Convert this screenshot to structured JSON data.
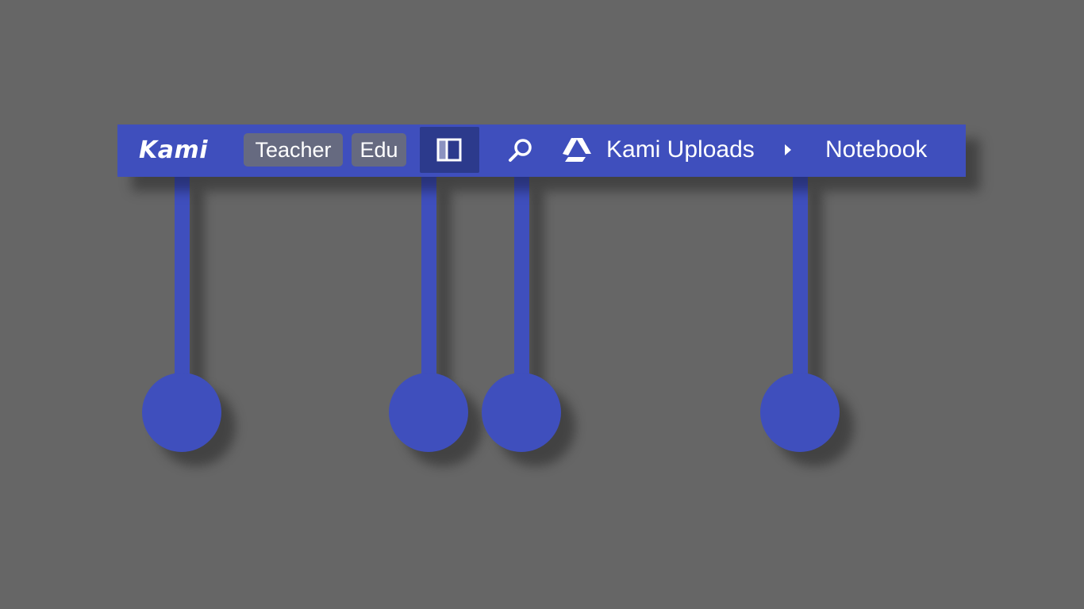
{
  "toolbar": {
    "logo": "Kami",
    "badges": [
      "Teacher",
      "Edu"
    ],
    "sidebar_toggle_icon": "sidebar-panel-icon",
    "search_icon": "search-icon",
    "drive_icon": "google-drive-icon",
    "breadcrumb": {
      "folder": "Kami Uploads",
      "separator_icon": "chevron-right-icon",
      "document": "Notebook"
    },
    "colors": {
      "bar": "#3f4fbd",
      "active_button": "#2c3a8c",
      "badge": "#666a80",
      "background": "#666666"
    }
  },
  "callouts": {
    "pointer_color": "#3f4fbd",
    "targets": [
      "logo",
      "sidebar-toggle",
      "search",
      "document-title"
    ]
  }
}
